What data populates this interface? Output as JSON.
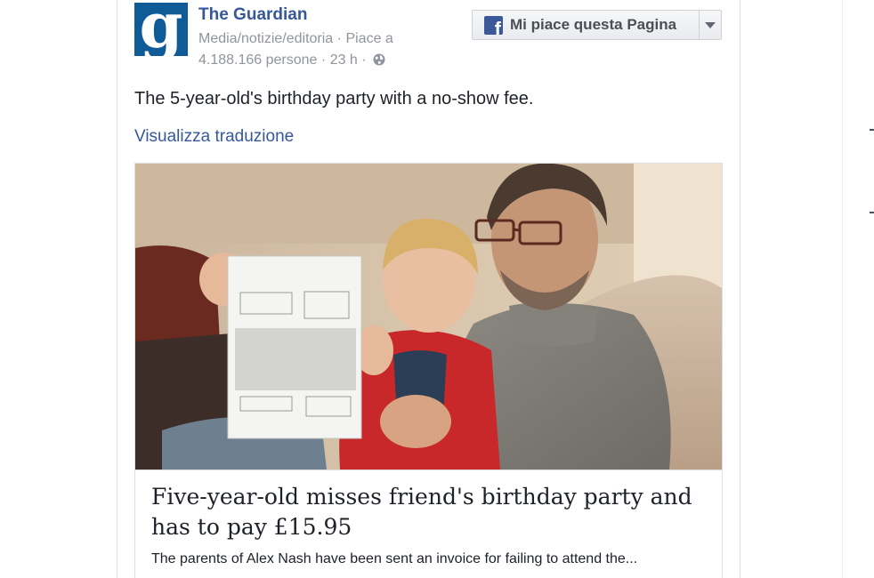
{
  "post": {
    "page_name": "The Guardian",
    "category": "Media/notizie/editoria",
    "likes_prefix": "Piace a",
    "likes_count": "4.188.166 persone",
    "time": "23 h",
    "separator": "·",
    "logo_letter": "g",
    "privacy_icon": "globe-icon",
    "text": "The 5-year-old's birthday party with a no-show fee.",
    "translate_link": "Visualizza traduzione"
  },
  "like_button": {
    "label": "Mi piace questa Pagina",
    "icon": "facebook-icon",
    "dropdown_icon": "chevron-down-icon"
  },
  "link_card": {
    "title": "Five-year-old misses friend's birthday party and has to pay £15.95",
    "description": "The parents of Alex Nash have been sent an invoice for failing to attend the..."
  },
  "colors": {
    "brand_link": "#365899",
    "guardian_blue": "#0f5b98",
    "facebook_blue": "#3b5998",
    "meta_grey": "#90949c"
  }
}
